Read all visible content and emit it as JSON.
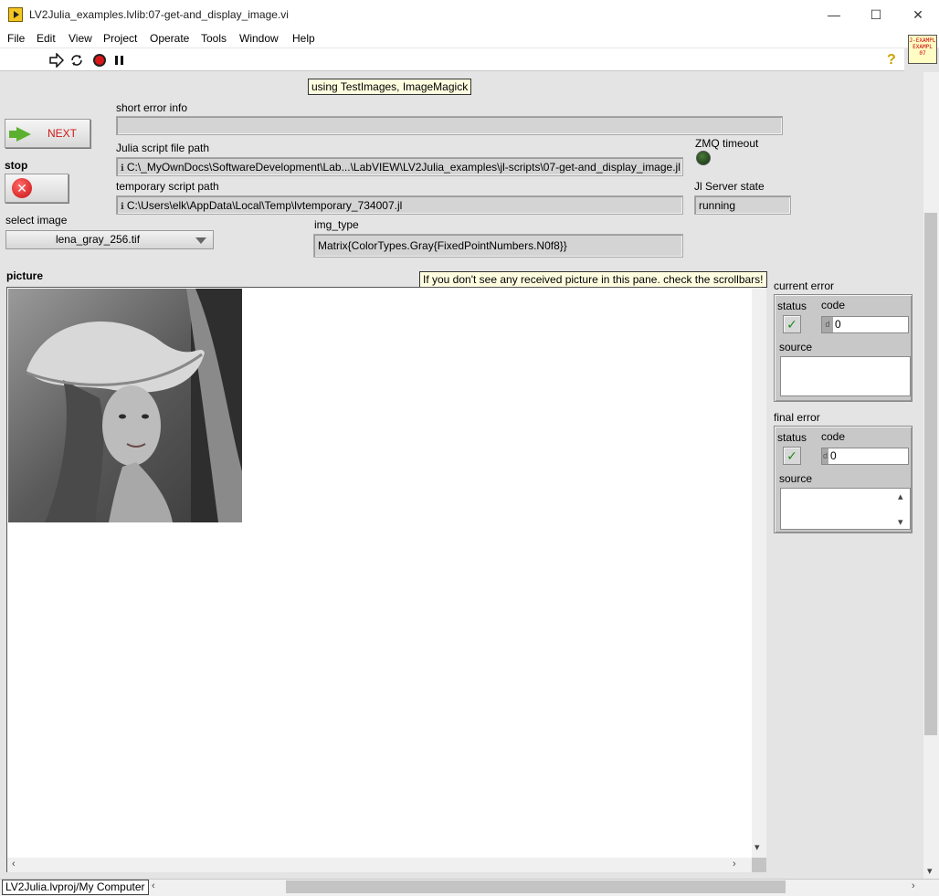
{
  "window": {
    "title": "LV2Julia_examples.lvlib:07-get-and_display_image.vi",
    "minimize": "—",
    "maximize": "☐",
    "close": "✕"
  },
  "menu": [
    "File",
    "Edit",
    "View",
    "Project",
    "Operate",
    "Tools",
    "Window",
    "Help"
  ],
  "vi_icon_text": [
    "J-EXAMPL",
    "EXAMPL",
    "07"
  ],
  "help_glyph": "?",
  "panel": {
    "tip_top": "using TestImages, ImageMagick",
    "short_error_label": "short error info",
    "short_error_value": "",
    "next_label": "NEXT",
    "stop_label": "stop",
    "julia_path_label": "Julia script file path",
    "julia_path_value": "C:\\_MyOwnDocs\\SoftwareDevelopment\\Lab...\\LabVIEW\\LV2Julia_examples\\jl-scripts\\07-get-and_display_image.jl",
    "temp_path_label": "temporary script path",
    "temp_path_value": "C:\\Users\\elk\\AppData\\Local\\Temp\\lvtemporary_734007.jl",
    "zmq_label": "ZMQ timeout",
    "jl_state_label": "Jl Server state",
    "jl_state_value": "running",
    "select_label": "select image",
    "select_value": "lena_gray_256.tif",
    "img_type_label": "img_type",
    "img_type_value": "Matrix{ColorTypes.Gray{FixedPointNumbers.N0f8}}",
    "picture_label": "picture",
    "tip_picture": "If you don't see any received picture in this pane. check the scrollbars!"
  },
  "current_error": {
    "title": "current error",
    "status_label": "status",
    "code_label": "code",
    "code_value": "0",
    "radix": "d",
    "source_label": "source",
    "source_value": ""
  },
  "final_error": {
    "title": "final error",
    "status_label": "status",
    "code_label": "code",
    "code_value": "0",
    "radix": "d",
    "source_label": "source",
    "source_value": ""
  },
  "status_bar": {
    "project_path": "LV2Julia.lvproj/My Computer"
  }
}
